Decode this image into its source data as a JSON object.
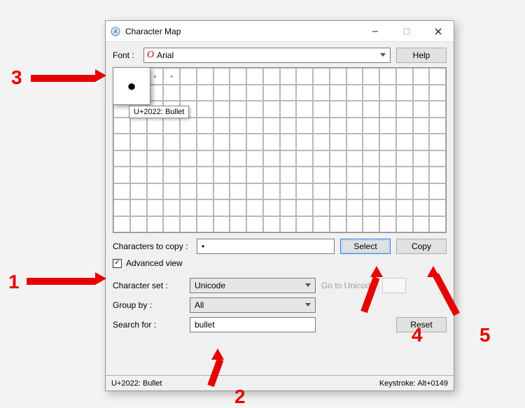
{
  "window": {
    "title": "Character Map"
  },
  "font": {
    "label": "Font :",
    "value": "Arial",
    "help": "Help"
  },
  "selected_char": {
    "glyph": "●",
    "tooltip": "U+2022: Bullet"
  },
  "grid_extra": {
    "cell2": "◦",
    "cell3": "◦"
  },
  "copy": {
    "label": "Characters to copy :",
    "value": "•",
    "select": "Select",
    "copy": "Copy"
  },
  "advanced": {
    "label": "Advanced view",
    "checked": "✓",
    "charset_label": "Character set :",
    "charset_value": "Unicode",
    "goto_label": "Go to Unicode :",
    "group_label": "Group by :",
    "group_value": "All",
    "search_label": "Search for :",
    "search_value": "bullet",
    "reset": "Reset"
  },
  "status": {
    "left": "U+2022: Bullet",
    "right": "Keystroke: Alt+0149"
  },
  "annotations": {
    "n1": "1",
    "n2": "2",
    "n3": "3",
    "n4": "4",
    "n5": "5"
  }
}
